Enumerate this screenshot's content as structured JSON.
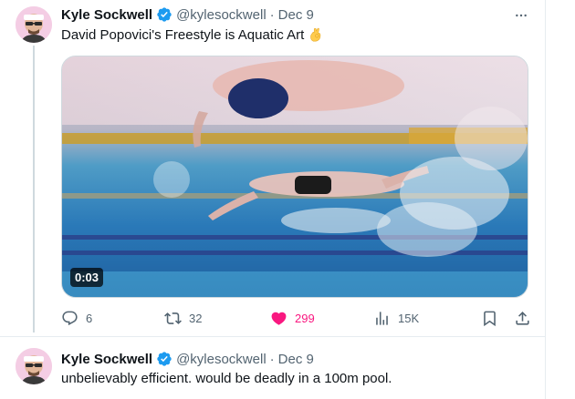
{
  "tweets": [
    {
      "author_name": "Kyle Sockwell",
      "handle": "@kylesockwell",
      "separator": "·",
      "time": "Dec 9",
      "text": "David Popovici's Freestyle is Aquatic Art",
      "emoji": "ok-hand-emoji",
      "media": {
        "type": "video",
        "duration": "0:03"
      },
      "actions": {
        "replies": "6",
        "reposts": "32",
        "likes": "299",
        "views": "15K"
      }
    },
    {
      "author_name": "Kyle Sockwell",
      "handle": "@kylesockwell",
      "separator": "·",
      "time": "Dec 9",
      "text": "unbelievably efficient. would be deadly in a 100m pool."
    }
  ],
  "colors": {
    "text_primary": "#0f1419",
    "text_secondary": "#536471",
    "verified": "#1d9bf0",
    "like": "#f91880",
    "border": "#cfd9de"
  },
  "icons": [
    "more-icon",
    "verified-badge-icon",
    "reply-icon",
    "repost-icon",
    "like-icon",
    "views-icon",
    "bookmark-icon",
    "share-icon"
  ]
}
